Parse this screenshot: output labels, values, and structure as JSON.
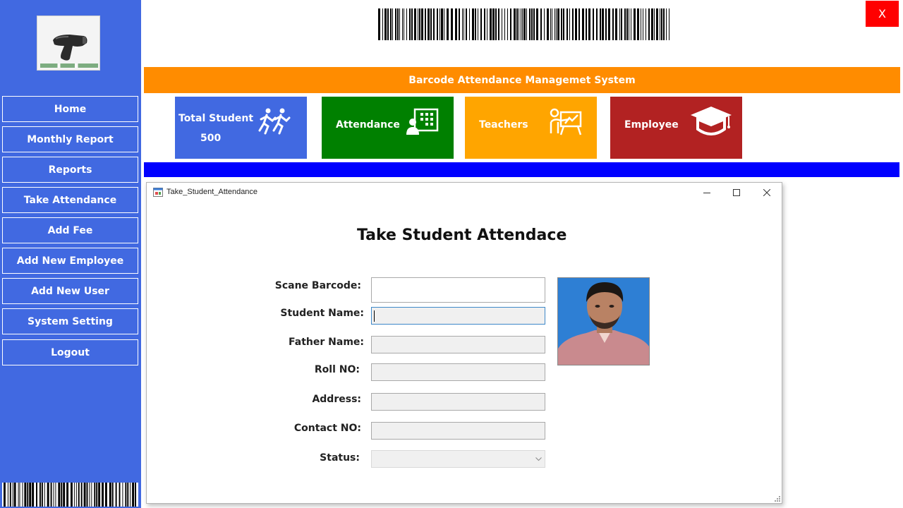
{
  "app": {
    "banner_title": "Barcode Attendance Managemet System",
    "close_label": "X"
  },
  "sidebar": {
    "items": [
      {
        "label": "Home"
      },
      {
        "label": "Monthly Report"
      },
      {
        "label": "Reports"
      },
      {
        "label": "Take Attendance"
      },
      {
        "label": "Add Fee"
      },
      {
        "label": "Add New Employee"
      },
      {
        "label": "Add New User"
      },
      {
        "label": "System Setting"
      },
      {
        "label": "Logout"
      }
    ]
  },
  "cards": {
    "total_student": {
      "label": "Total Student",
      "value": "500",
      "icon": "students-running-icon",
      "color": "#4169e1"
    },
    "attendance": {
      "label": "Attendance",
      "icon": "attendance-board-icon",
      "color": "#008000"
    },
    "teachers": {
      "label": "Teachers",
      "icon": "teacher-board-icon",
      "color": "#ffa500"
    },
    "employee": {
      "label": "Employee",
      "icon": "graduation-cap-icon",
      "color": "#b22222"
    }
  },
  "dialog": {
    "window_title": "Take_Student_Attendance",
    "heading": "Take Student Attendace",
    "fields": {
      "barcode_label": "Scane Barcode:",
      "barcode_value": "",
      "student_name_label": "Student Name:",
      "student_name_value": "",
      "father_name_label": "Father Name:",
      "father_name_value": "",
      "roll_label": "Roll NO:",
      "roll_value": "",
      "address_label": "Address:",
      "address_value": "",
      "contact_label": "Contact NO:",
      "contact_value": "",
      "status_label": "Status:",
      "status_value": ""
    }
  },
  "colors": {
    "sidebar": "#4169e1",
    "banner": "#ff8c00",
    "blue_band": "#0000ff",
    "close": "#ff0000"
  }
}
